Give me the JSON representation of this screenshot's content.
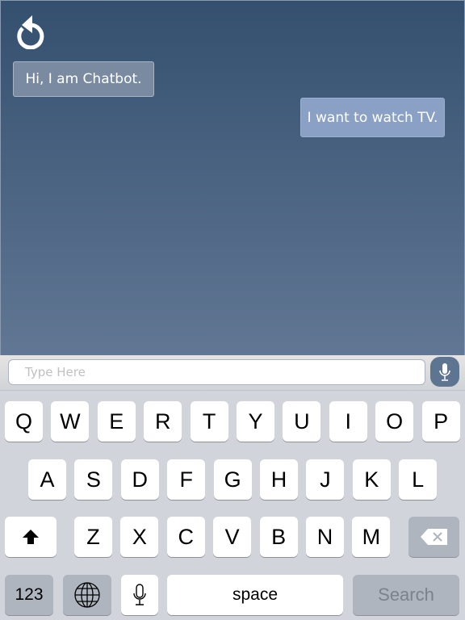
{
  "chat": {
    "messages": [
      {
        "from": "bot",
        "text": "Hi, I am Chatbot."
      },
      {
        "from": "user",
        "text": "I want to watch TV."
      }
    ],
    "refresh_icon": "refresh-icon"
  },
  "input": {
    "placeholder": "Type Here",
    "value": "",
    "mic_icon": "microphone-icon"
  },
  "keyboard": {
    "row1": [
      "Q",
      "W",
      "E",
      "R",
      "T",
      "Y",
      "U",
      "I",
      "O",
      "P"
    ],
    "row2": [
      "A",
      "S",
      "D",
      "F",
      "G",
      "H",
      "J",
      "K",
      "L"
    ],
    "row3": [
      "Z",
      "X",
      "C",
      "V",
      "B",
      "N",
      "M"
    ],
    "numbers_label": "123",
    "space_label": "space",
    "search_label": "Search",
    "shift_icon": "shift-arrow-icon",
    "backspace_icon": "backspace-icon",
    "globe_icon": "globe-icon",
    "dictation_icon": "microphone-icon"
  }
}
